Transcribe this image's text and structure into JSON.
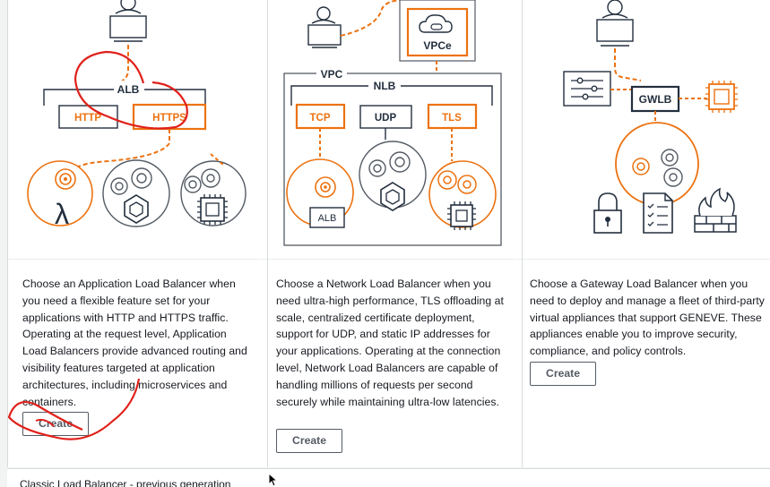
{
  "cards": [
    {
      "id": "alb",
      "illustration": {
        "top_box": "ALB",
        "listeners": [
          "HTTP",
          "HTTPS"
        ],
        "targets": [
          "lambda-icon",
          "container-icon",
          "chip-icon"
        ]
      },
      "description": "Choose an Application Load Balancer when you need a flexible feature set for your applications with HTTP and HTTPS traffic. Operating at the request level, Application Load Balancers provide advanced routing and visibility features targeted at application architectures, including microservices and containers.",
      "create_label": "Create"
    },
    {
      "id": "nlb",
      "illustration": {
        "endpoint_box": "VPCe",
        "vpc_label": "VPC",
        "top_box": "NLB",
        "listeners": [
          "TCP",
          "UDP",
          "TLS"
        ],
        "target_alb": "ALB",
        "targets": [
          "alb-icon",
          "container-icon",
          "chip-icon"
        ]
      },
      "description": "Choose a Network Load Balancer when you need ultra-high performance, TLS offloading at scale, centralized certificate deployment, support for UDP, and static IP addresses for your applications. Operating at the connection level, Network Load Balancers are capable of handling millions of requests per second securely while maintaining ultra-low latencies.",
      "create_label": "Create"
    },
    {
      "id": "gwlb",
      "illustration": {
        "top_box": "GWLB",
        "targets": [
          "lock-icon",
          "checklist-icon",
          "firewall-icon"
        ]
      },
      "description": "Choose a Gateway Load Balancer when you need to deploy and manage a fleet of third-party virtual appliances that support GENEVE. These appliances enable you to improve security, compliance, and policy controls.",
      "create_label": "Create"
    }
  ],
  "bottom_section": {
    "label": "Classic Load Balancer - previous generation"
  },
  "colors": {
    "accent": "#ec7211",
    "text": "#16191f",
    "border": "#545b64",
    "annotation": "#e0211b"
  }
}
